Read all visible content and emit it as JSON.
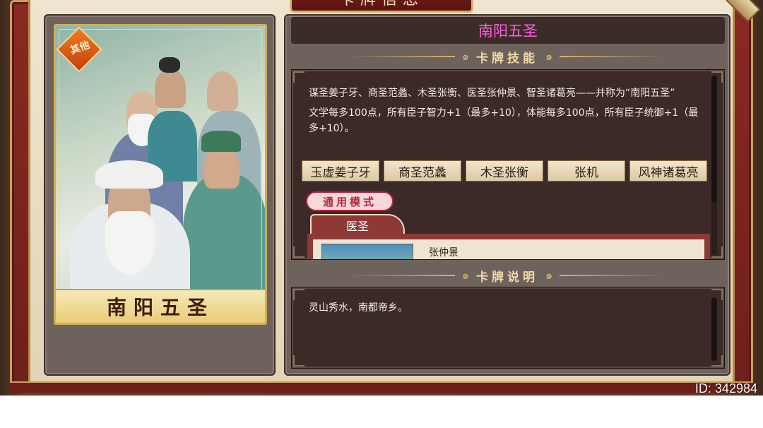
{
  "header": {
    "title": "卡牌信息"
  },
  "card": {
    "badge": "其他",
    "name_plate": "南阳五圣"
  },
  "detail": {
    "card_name": "南阳五圣",
    "skill_section_label": "卡牌技能",
    "skill_desc_1": "谋圣姜子牙、商圣范蠡、木圣张衡、医圣张仲景、智圣诸葛亮——并称为“南阳五圣”",
    "skill_desc_2": "文学每多100点，所有臣子智力+1（最多+10），体能每多100点，所有臣子统御+1（最多+10）。",
    "members": [
      "玉虚姜子牙",
      "商圣范蠡",
      "木圣张衡",
      "张机",
      "风神诸葛亮"
    ],
    "mode_tag": "通用模式",
    "active_tab": "医圣",
    "active_member_name": "张仲景",
    "desc_section_label": "卡牌说明",
    "description": "灵山秀水，南都帝乡。"
  },
  "footer": {
    "id_label": "ID: 342984"
  },
  "colors": {
    "card_name": "#ff5de0",
    "frame": "#8a2a22",
    "gold": "#d7b26a"
  }
}
